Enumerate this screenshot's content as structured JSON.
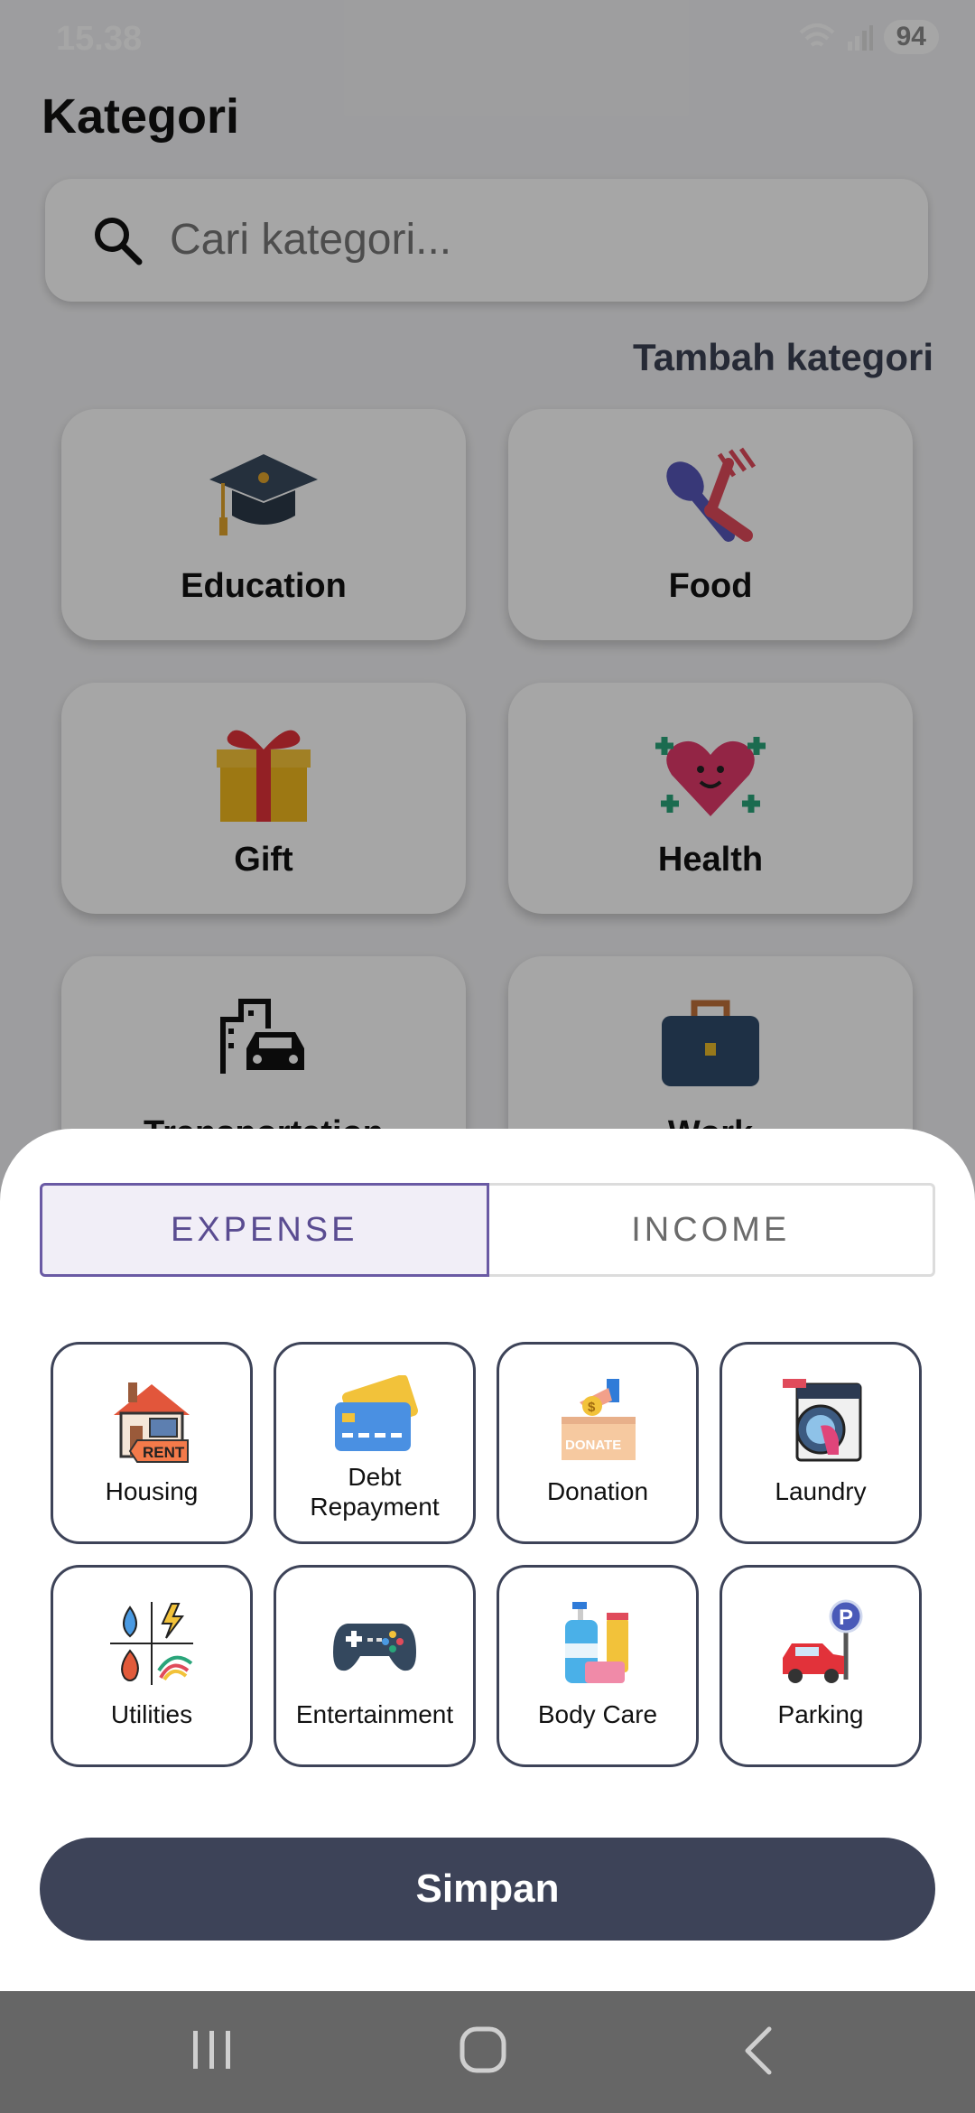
{
  "status_bar": {
    "time": "15.38",
    "battery": "94"
  },
  "page": {
    "title": "Kategori",
    "search": {
      "placeholder": "Cari kategori..."
    },
    "add_category_label": "Tambah kategori",
    "categories": [
      {
        "label": "Education",
        "icon": "graduation-cap-icon"
      },
      {
        "label": "Food",
        "icon": "fork-spoon-icon"
      },
      {
        "label": "Gift",
        "icon": "gift-box-icon"
      },
      {
        "label": "Health",
        "icon": "heart-health-icon"
      },
      {
        "label": "Transportation",
        "icon": "city-car-icon"
      },
      {
        "label": "Work",
        "icon": "briefcase-icon"
      }
    ]
  },
  "sheet": {
    "tabs": [
      {
        "label": "EXPENSE",
        "active": true
      },
      {
        "label": "INCOME",
        "active": false
      }
    ],
    "options": [
      {
        "label": "Housing",
        "icon": "house-rent-icon"
      },
      {
        "label": "Debt\nRepayment",
        "icon": "credit-card-icon"
      },
      {
        "label": "Donation",
        "icon": "donate-box-icon"
      },
      {
        "label": "Laundry",
        "icon": "washing-machine-icon"
      },
      {
        "label": "Utilities",
        "icon": "utilities-icon"
      },
      {
        "label": "Entertainment",
        "icon": "gamepad-icon"
      },
      {
        "label": "Body Care",
        "icon": "body-care-icon"
      },
      {
        "label": "Parking",
        "icon": "parking-car-icon"
      }
    ],
    "save_label": "Simpan"
  },
  "colors": {
    "primary": "#3d4358",
    "accent": "#5a4c91",
    "overlay": "rgba(0,0,0,0.35)"
  }
}
